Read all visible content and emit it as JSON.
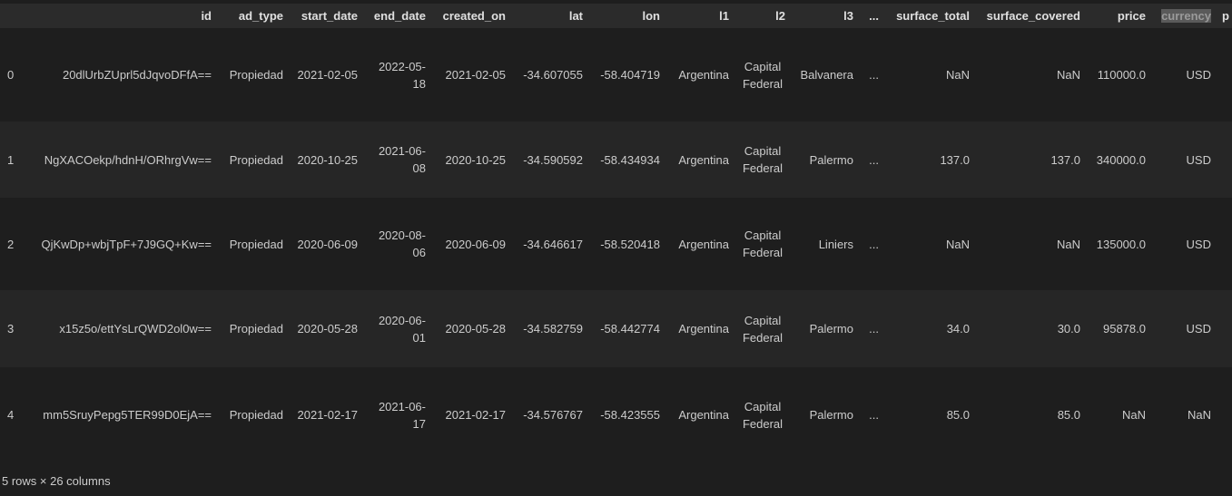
{
  "table": {
    "columns": [
      "",
      "id",
      "ad_type",
      "start_date",
      "end_date",
      "created_on",
      "lat",
      "lon",
      "l1",
      "l2",
      "l3",
      "...",
      "surface_total",
      "surface_covered",
      "price",
      "currency",
      "p"
    ],
    "highlighted_column": "currency",
    "rows": [
      [
        "0",
        "20dlUrbZUprl5dJqvoDFfA==",
        "Propiedad",
        "2021-02-05",
        "2022-05-18",
        "2021-02-05",
        "-34.607055",
        "-58.404719",
        "Argentina",
        "Capital Federal",
        "Balvanera",
        "...",
        "NaN",
        "NaN",
        "110000.0",
        "USD",
        ""
      ],
      [
        "1",
        "NgXACOekp/hdnH/ORhrgVw==",
        "Propiedad",
        "2020-10-25",
        "2021-06-08",
        "2020-10-25",
        "-34.590592",
        "-58.434934",
        "Argentina",
        "Capital Federal",
        "Palermo",
        "...",
        "137.0",
        "137.0",
        "340000.0",
        "USD",
        ""
      ],
      [
        "2",
        "QjKwDp+wbjTpF+7J9GQ+Kw==",
        "Propiedad",
        "2020-06-09",
        "2020-08-06",
        "2020-06-09",
        "-34.646617",
        "-58.520418",
        "Argentina",
        "Capital Federal",
        "Liniers",
        "...",
        "NaN",
        "NaN",
        "135000.0",
        "USD",
        ""
      ],
      [
        "3",
        "x15z5o/ettYsLrQWD2ol0w==",
        "Propiedad",
        "2020-05-28",
        "2020-06-01",
        "2020-05-28",
        "-34.582759",
        "-58.442774",
        "Argentina",
        "Capital Federal",
        "Palermo",
        "...",
        "34.0",
        "30.0",
        "95878.0",
        "USD",
        ""
      ],
      [
        "4",
        "mm5SruyPepg5TER99D0EjA==",
        "Propiedad",
        "2021-02-17",
        "2021-06-17",
        "2021-02-17",
        "-34.576767",
        "-58.423555",
        "Argentina",
        "Capital Federal",
        "Palermo",
        "...",
        "85.0",
        "85.0",
        "NaN",
        "NaN",
        ""
      ]
    ]
  },
  "footer": "5 rows × 26 columns",
  "colors": {
    "background": "#1e1e1e",
    "header_bg": "#2b2b2b",
    "alt_row_bg": "#262626",
    "text": "#cccccc"
  }
}
